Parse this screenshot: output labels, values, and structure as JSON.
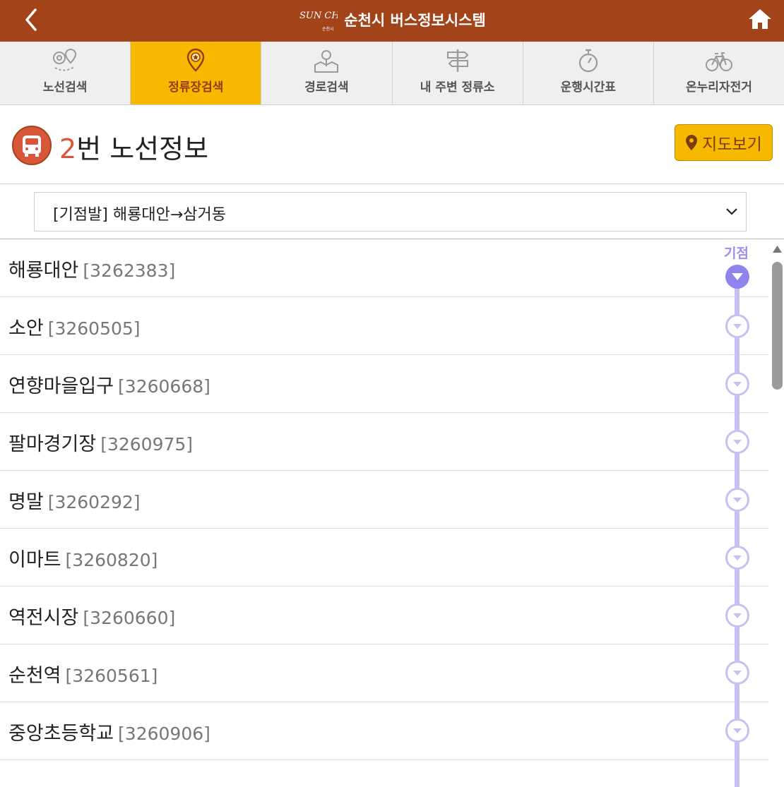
{
  "header": {
    "title": "순천시 버스정보시스템",
    "logo_text": "SUN CHEON",
    "logo_small": "순천시",
    "back_icon": "chevron-left-icon",
    "home_icon": "home-icon"
  },
  "tabs": [
    {
      "label": "노선검색",
      "icon": "route-search-icon",
      "active": false
    },
    {
      "label": "정류장검색",
      "icon": "stop-search-icon",
      "active": true
    },
    {
      "label": "경로검색",
      "icon": "path-search-icon",
      "active": false
    },
    {
      "label": "내 주변 정류소",
      "icon": "signpost-icon",
      "active": false
    },
    {
      "label": "운행시간표",
      "icon": "stopwatch-icon",
      "active": false
    },
    {
      "label": "온누리자전거",
      "icon": "bicycle-icon",
      "active": false
    }
  ],
  "route": {
    "number": "2",
    "title_suffix": "번 노선정보",
    "map_button": "지도보기"
  },
  "direction": {
    "selected": "[기점발] 해룡대안→삼거동"
  },
  "timeline": {
    "start_label": "기점"
  },
  "stops": [
    {
      "name": "해룡대안",
      "id": "[3262383]"
    },
    {
      "name": "소안",
      "id": "[3260505]"
    },
    {
      "name": "연향마을입구",
      "id": "[3260668]"
    },
    {
      "name": "팔마경기장",
      "id": "[3260975]"
    },
    {
      "name": "명말",
      "id": "[3260292]"
    },
    {
      "name": "이마트",
      "id": "[3260820]"
    },
    {
      "name": "역전시장",
      "id": "[3260660]"
    },
    {
      "name": "순천역",
      "id": "[3260561]"
    },
    {
      "name": "중앙초등학교",
      "id": "[3260906]"
    }
  ],
  "colors": {
    "header_bg": "#a3431a",
    "tab_active": "#f6b900",
    "accent": "#d8563a",
    "timeline": "#c8bff3",
    "timeline_active": "#8f84ec"
  }
}
